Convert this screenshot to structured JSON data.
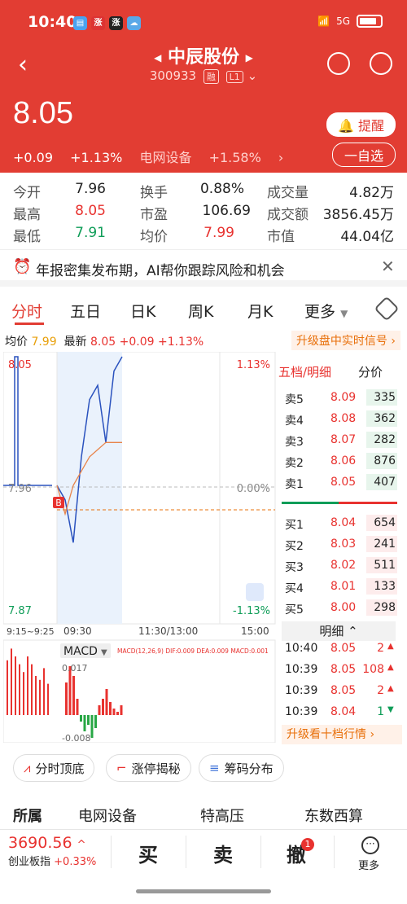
{
  "status_bar": {
    "time": "10:40",
    "network": "5G"
  },
  "header": {
    "title": "中辰股份",
    "code": "300933",
    "tag_rong": "融",
    "tag_level": "L1",
    "price": "8.05",
    "change": "+0.09",
    "change_pct": "+1.13%",
    "sector": "电网设备",
    "sector_pct": "+1.58%",
    "remind_label": "提醒",
    "watchlist_label": "一自选"
  },
  "stats": [
    {
      "label": "今开",
      "value": "7.96"
    },
    {
      "label": "换手",
      "value": "0.88%"
    },
    {
      "label": "成交量",
      "value": "4.82万"
    },
    {
      "label": "最高",
      "value": "8.05"
    },
    {
      "label": "市盈",
      "value": "106.69"
    },
    {
      "label": "成交额",
      "value": "3856.45万"
    },
    {
      "label": "最低",
      "value": "7.91"
    },
    {
      "label": "均价",
      "value": "7.99"
    },
    {
      "label": "市值",
      "value": "44.04亿"
    }
  ],
  "banner": {
    "text": "年报密集发布期，AI帮你跟踪风险和机会"
  },
  "tabs": [
    "分时",
    "五日",
    "日K",
    "周K",
    "月K",
    "更多"
  ],
  "info_bar": {
    "avg_label": "均价",
    "avg_value": "7.99",
    "latest_label": "最新",
    "latest_value": "8.05",
    "change": "+0.09",
    "change_pct": "+1.13%",
    "upgrade": "升级盘中实时信号"
  },
  "chart": {
    "y_top": "8.05",
    "y_mid": "7.96",
    "y_bottom": "7.87",
    "pct_top": "1.13%",
    "pct_mid": "0.00%",
    "pct_bottom": "-1.13%",
    "x_labels": [
      "9:15~9:25",
      "09:30",
      "11:30/13:00",
      "15:00"
    ],
    "marker": "B",
    "macd_label": "MACD",
    "macd_params": "MACD(12,26,9) DIF:0.009 DEA:0.009 MACD:0.001",
    "macd_top": "0.017",
    "macd_bottom": "-0.008"
  },
  "chart_data": {
    "type": "line",
    "series": [
      {
        "name": "最新",
        "values": [
          7.96,
          7.95,
          7.92,
          7.98,
          8.02,
          8.03,
          7.99,
          8.04,
          8.05
        ]
      },
      {
        "name": "均价",
        "values": [
          7.96,
          7.94,
          7.96,
          7.97,
          7.98,
          7.985,
          7.99,
          7.99,
          7.99
        ]
      }
    ],
    "ylim": [
      7.87,
      8.05
    ]
  },
  "orderbook": {
    "tab_five": "五档/明细",
    "tab_minute": "分价",
    "asks": [
      {
        "label": "卖5",
        "price": "8.09",
        "vol": "335"
      },
      {
        "label": "卖4",
        "price": "8.08",
        "vol": "362"
      },
      {
        "label": "卖3",
        "price": "8.07",
        "vol": "282"
      },
      {
        "label": "卖2",
        "price": "8.06",
        "vol": "876"
      },
      {
        "label": "卖1",
        "price": "8.05",
        "vol": "407"
      }
    ],
    "bids": [
      {
        "label": "买1",
        "price": "8.04",
        "vol": "654"
      },
      {
        "label": "买2",
        "price": "8.03",
        "vol": "241"
      },
      {
        "label": "买3",
        "price": "8.02",
        "vol": "511"
      },
      {
        "label": "买4",
        "price": "8.01",
        "vol": "133"
      },
      {
        "label": "买5",
        "price": "8.00",
        "vol": "298"
      }
    ],
    "detail_title": "明细",
    "trades": [
      {
        "time": "10:40",
        "price": "8.05",
        "vol": "2"
      },
      {
        "time": "10:39",
        "price": "8.05",
        "vol": "108"
      },
      {
        "time": "10:39",
        "price": "8.05",
        "vol": "2"
      },
      {
        "time": "10:39",
        "price": "8.04",
        "vol": "1"
      }
    ],
    "upgrade": "升级看十档行情"
  },
  "tools": [
    "分时顶底",
    "涨停揭秘",
    "筹码分布"
  ],
  "sectors": [
    "所属",
    "电网设备",
    "特高压",
    "东数西算"
  ],
  "bottom": {
    "index_value": "3690.56",
    "index_name": "创业板指",
    "index_pct": "+0.33%",
    "buy": "买",
    "sell": "卖",
    "cancel": "撤",
    "cancel_badge": "1",
    "more": "更多"
  }
}
